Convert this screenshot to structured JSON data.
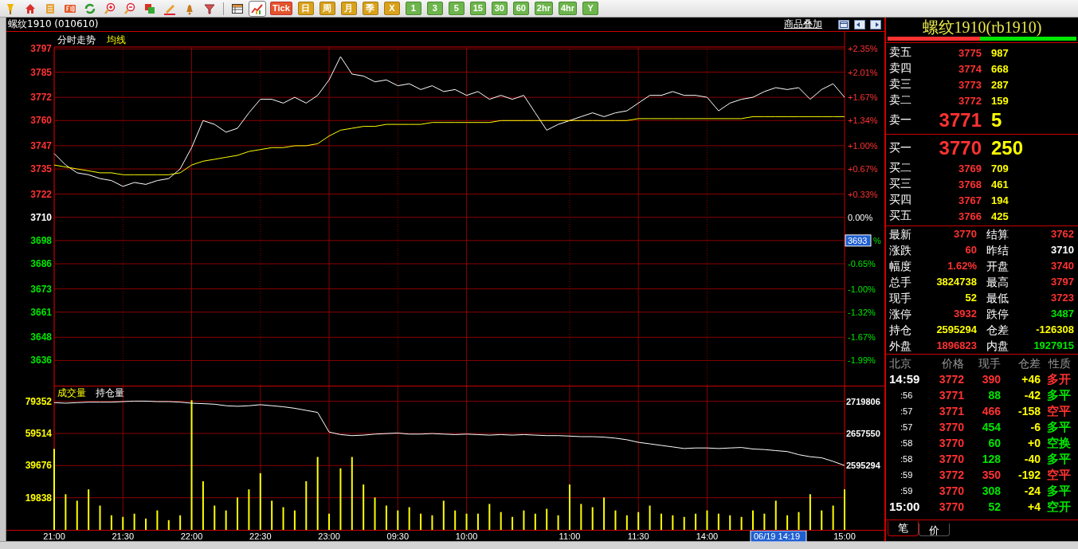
{
  "toolbar": {
    "tools": [
      {
        "kind": "pin",
        "selected": false
      },
      {
        "kind": "home",
        "selected": false
      },
      {
        "kind": "book",
        "selected": false
      },
      {
        "kind": "f10",
        "selected": false
      },
      {
        "kind": "refresh",
        "selected": false
      },
      {
        "kind": "zoom-in",
        "selected": false
      },
      {
        "kind": "zoom-out",
        "selected": false
      },
      {
        "kind": "windows",
        "selected": false
      },
      {
        "kind": "pen",
        "selected": false
      },
      {
        "kind": "bell",
        "selected": false
      },
      {
        "kind": "filter",
        "selected": false
      },
      {
        "kind": "table",
        "selected": false
      },
      {
        "kind": "chart",
        "selected": true
      }
    ],
    "periods": [
      {
        "label": "Tick",
        "kind": "tick"
      },
      {
        "label": "日",
        "kind": "period"
      },
      {
        "label": "周",
        "kind": "period"
      },
      {
        "label": "月",
        "kind": "period"
      },
      {
        "label": "季",
        "kind": "period"
      },
      {
        "label": "X",
        "kind": "period"
      },
      {
        "label": "1",
        "kind": "minute"
      },
      {
        "label": "3",
        "kind": "minute"
      },
      {
        "label": "5",
        "kind": "minute"
      },
      {
        "label": "15",
        "kind": "minute"
      },
      {
        "label": "30",
        "kind": "minute"
      },
      {
        "label": "60",
        "kind": "minute"
      },
      {
        "label": "2hr",
        "kind": "minute"
      },
      {
        "label": "4hr",
        "kind": "minute"
      },
      {
        "label": "Y",
        "kind": "minute"
      }
    ]
  },
  "chart_header": {
    "title": "螺纹1910 (010610)",
    "overlay_link": "商品叠加"
  },
  "price_chart": {
    "right_labels": [
      "+2.35%",
      "+2.01%",
      "+1.67%",
      "+1.34%",
      "+1.00%",
      "+0.67%",
      "+0.33%",
      "0.00%",
      "%",
      "-0.65%",
      "-1.00%",
      "-1.32%",
      "-1.67%",
      "-1.99%"
    ],
    "cursor_price": "3693",
    "chart_data": {
      "type": "line",
      "grid": true,
      "series": [
        {
          "name": "分时走势",
          "color": "#ffffff",
          "values": [
            3743,
            3737,
            3733,
            3732,
            3730,
            3729,
            3726,
            3728,
            3727,
            3729,
            3730,
            3735,
            3746,
            3760,
            3758,
            3754,
            3756,
            3764,
            3771,
            3771,
            3769,
            3772,
            3769,
            3773,
            3781,
            3793,
            3784,
            3783,
            3780,
            3781,
            3778,
            3779,
            3776,
            3778,
            3775,
            3776,
            3773,
            3775,
            3771,
            3773,
            3771,
            3773,
            3764,
            3755,
            3758,
            3760,
            3762,
            3764,
            3762,
            3764,
            3765,
            3769,
            3773,
            3773,
            3775,
            3773,
            3773,
            3772,
            3765,
            3769,
            3771,
            3772,
            3775,
            3777,
            3776,
            3777,
            3771,
            3776,
            3779,
            3772
          ]
        },
        {
          "name": "均线",
          "color": "#ffff00",
          "values": [
            3737,
            3736,
            3735,
            3734,
            3733,
            3733,
            3732,
            3732,
            3732,
            3732,
            3732,
            3733,
            3737,
            3739,
            3740,
            3741,
            3742,
            3744,
            3745,
            3746,
            3746,
            3747,
            3747,
            3748,
            3752,
            3755,
            3756,
            3757,
            3757,
            3758,
            3758,
            3758,
            3758,
            3759,
            3759,
            3759,
            3759,
            3759,
            3759,
            3760,
            3760,
            3760,
            3760,
            3760,
            3760,
            3760,
            3760,
            3760,
            3760,
            3760,
            3760,
            3761,
            3761,
            3761,
            3761,
            3761,
            3761,
            3761,
            3761,
            3761,
            3761,
            3762,
            3762,
            3762,
            3762,
            3762,
            3762,
            3762,
            3762,
            3762
          ]
        }
      ],
      "ylim": [
        3623,
        3798
      ],
      "yticks": [
        3797,
        3785,
        3772,
        3760,
        3747,
        3735,
        3722,
        3710,
        3698,
        3686,
        3673,
        3661,
        3648,
        3636
      ]
    }
  },
  "volume_chart": {
    "chart_data": {
      "type": "bar",
      "grid": true,
      "categories": [
        "21:00",
        null,
        null,
        null,
        null,
        null,
        "21:30",
        null,
        null,
        null,
        null,
        null,
        "22:00",
        null,
        null,
        null,
        null,
        null,
        "22:30",
        null,
        null,
        null,
        null,
        null,
        "23:00",
        null,
        null,
        null,
        null,
        null,
        "09:30",
        null,
        null,
        null,
        null,
        null,
        "10:00",
        null,
        null,
        null,
        null,
        null,
        null,
        null,
        null,
        "11:00",
        null,
        null,
        null,
        null,
        null,
        "11:30",
        null,
        null,
        null,
        null,
        null,
        "14:00",
        null,
        null,
        null,
        null,
        null,
        null,
        null,
        null,
        null,
        null,
        null,
        "15:00"
      ],
      "series": [
        {
          "name": "成交量",
          "color": "#ffff00",
          "values": [
            50000,
            22000,
            18000,
            25000,
            15000,
            9000,
            8000,
            10000,
            7000,
            12000,
            6000,
            9000,
            80000,
            30000,
            15000,
            12000,
            20000,
            25000,
            35000,
            18000,
            14000,
            12000,
            30000,
            45000,
            10000,
            38000,
            45000,
            28000,
            20000,
            15000,
            12000,
            14000,
            10000,
            9000,
            18000,
            12000,
            10000,
            10000,
            16000,
            11000,
            8000,
            12000,
            10000,
            13000,
            9000,
            28000,
            16000,
            14000,
            20000,
            12000,
            9000,
            11000,
            15000,
            10000,
            9000,
            8000,
            10000,
            12000,
            10000,
            9000,
            8000,
            12000,
            10000,
            18000,
            9000,
            11000,
            22000,
            12000,
            15000,
            25000
          ]
        }
      ],
      "ylim": [
        0,
        89000
      ],
      "yticks": [
        79352,
        59514,
        39676,
        19838
      ]
    }
  },
  "interest_chart": {
    "chart_data": {
      "type": "line",
      "series": [
        {
          "name": "持仓量",
          "color": "#ffffff",
          "values": [
            2717000,
            2716000,
            2717000,
            2718000,
            2718000,
            2718000,
            2719000,
            2720000,
            2720000,
            2719000,
            2719000,
            2718000,
            2716000,
            2715000,
            2714000,
            2711000,
            2710000,
            2711000,
            2713000,
            2711000,
            2709000,
            2706000,
            2702000,
            2698000,
            2660000,
            2655000,
            2653000,
            2654000,
            2656000,
            2657000,
            2658000,
            2656000,
            2656000,
            2657000,
            2656000,
            2655000,
            2656000,
            2655000,
            2654000,
            2655000,
            2654000,
            2655000,
            2654000,
            2653000,
            2653000,
            2652000,
            2651000,
            2651000,
            2650000,
            2648000,
            2645000,
            2640000,
            2637000,
            2634000,
            2631000,
            2628000,
            2629000,
            2629000,
            2628000,
            2629000,
            2630000,
            2627000,
            2626000,
            2624000,
            2622000,
            2616000,
            2612000,
            2610000,
            2603000,
            2595000
          ]
        }
      ],
      "ylim": [
        2470000,
        2750000
      ],
      "yticks": [
        2719806,
        2657550,
        2595294
      ]
    }
  },
  "time_cursor": {
    "label": "06/19 14:19"
  },
  "quote": {
    "title": "螺纹1910(rb1910)",
    "ratio_bar": {
      "level": 0.49
    },
    "asks": [
      {
        "label": "卖五",
        "price": "3775",
        "volume": "987",
        "kind": "level"
      },
      {
        "label": "卖四",
        "price": "3774",
        "volume": "668",
        "kind": "level"
      },
      {
        "label": "卖三",
        "price": "3773",
        "volume": "287",
        "kind": "level"
      },
      {
        "label": "卖二",
        "price": "3772",
        "volume": "159",
        "kind": "level"
      },
      {
        "label": "卖一",
        "price": "3771",
        "volume": "5",
        "kind": "best"
      }
    ],
    "bids": [
      {
        "label": "买一",
        "price": "3770",
        "volume": "250",
        "kind": "best"
      },
      {
        "label": "买二",
        "price": "3769",
        "volume": "709",
        "kind": "level"
      },
      {
        "label": "买三",
        "price": "3768",
        "volume": "461",
        "kind": "level"
      },
      {
        "label": "买四",
        "price": "3767",
        "volume": "194",
        "kind": "level"
      },
      {
        "label": "买五",
        "price": "3766",
        "volume": "425",
        "kind": "level"
      }
    ],
    "stats": [
      {
        "label": "最新",
        "value": "3770",
        "color": "#ff3232"
      },
      {
        "label": "结算",
        "value": "3762",
        "color": "#ff3232"
      },
      {
        "label": "涨跌",
        "value": "60",
        "color": "#ff3232"
      },
      {
        "label": "昨结",
        "value": "3710",
        "color": "#ffffff"
      },
      {
        "label": "幅度",
        "value": "1.62%",
        "color": "#ff3232"
      },
      {
        "label": "开盘",
        "value": "3740",
        "color": "#ff3232"
      },
      {
        "label": "总手",
        "value": "3824738",
        "color": "#ffff00"
      },
      {
        "label": "最高",
        "value": "3797",
        "color": "#ff3232"
      },
      {
        "label": "现手",
        "value": "52",
        "color": "#ffff00"
      },
      {
        "label": "最低",
        "value": "3723",
        "color": "#ff3232"
      },
      {
        "label": "涨停",
        "value": "3932",
        "color": "#ff3232"
      },
      {
        "label": "跌停",
        "value": "3487",
        "color": "#00e600"
      },
      {
        "label": "持仓",
        "value": "2595294",
        "color": "#ffff00"
      },
      {
        "label": "仓差",
        "value": "-126308",
        "color": "#ffff00"
      },
      {
        "label": "外盘",
        "value": "1896823",
        "color": "#ff3232"
      },
      {
        "label": "内盘",
        "value": "1927915",
        "color": "#00e600"
      }
    ],
    "ticks_header": [
      "北京",
      "价格",
      "现手",
      "仓差",
      "性质"
    ],
    "ticks": [
      {
        "time": "14:59",
        "kind": "full",
        "price": "3772",
        "hand": {
          "text": "390",
          "color": "#ff3232"
        },
        "diff": "+46",
        "nature": {
          "text": "多开",
          "color": "#ff3232"
        }
      },
      {
        "time": ":56",
        "kind": "short",
        "price": "3771",
        "hand": {
          "text": "88",
          "color": "#00e600"
        },
        "diff": "-42",
        "nature": {
          "text": "多平",
          "color": "#00e600"
        }
      },
      {
        "time": ":57",
        "kind": "short",
        "price": "3771",
        "hand": {
          "text": "466",
          "color": "#ff3232"
        },
        "diff": "-158",
        "nature": {
          "text": "空平",
          "color": "#ff3232"
        }
      },
      {
        "time": ":57",
        "kind": "short",
        "price": "3770",
        "hand": {
          "text": "454",
          "color": "#00e600"
        },
        "diff": "-6",
        "nature": {
          "text": "多平",
          "color": "#00e600"
        }
      },
      {
        "time": ":58",
        "kind": "short",
        "price": "3770",
        "hand": {
          "text": "60",
          "color": "#00e600"
        },
        "diff": "+0",
        "nature": {
          "text": "空换",
          "color": "#00e600"
        }
      },
      {
        "time": ":58",
        "kind": "short",
        "price": "3770",
        "hand": {
          "text": "128",
          "color": "#00e600"
        },
        "diff": "-40",
        "nature": {
          "text": "多平",
          "color": "#00e600"
        }
      },
      {
        "time": ":59",
        "kind": "short",
        "price": "3772",
        "hand": {
          "text": "350",
          "color": "#ff3232"
        },
        "diff": "-192",
        "nature": {
          "text": "空平",
          "color": "#ff3232"
        }
      },
      {
        "time": ":59",
        "kind": "short",
        "price": "3770",
        "hand": {
          "text": "308",
          "color": "#00e600"
        },
        "diff": "-24",
        "nature": {
          "text": "多平",
          "color": "#00e600"
        }
      },
      {
        "time": "15:00",
        "kind": "full",
        "price": "3770",
        "hand": {
          "text": "52",
          "color": "#00e600"
        },
        "diff": "+4",
        "nature": {
          "text": "空开",
          "color": "#00e600"
        }
      }
    ],
    "tabs": [
      {
        "label": "笔",
        "selected": true
      },
      {
        "label": "价",
        "selected": false
      }
    ]
  }
}
